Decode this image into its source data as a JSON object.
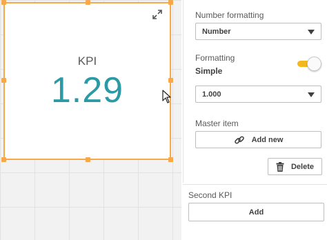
{
  "kpi": {
    "label": "KPI",
    "value": "1.29",
    "value_color": "#2b9aa5",
    "selection_color": "#f5a94a",
    "expand_icon": "expand-icon",
    "cursor_icon": "pointer-cursor-icon"
  },
  "panel": {
    "number_formatting_label": "Number formatting",
    "number_formatting_value": "Number",
    "formatting_label": "Formatting",
    "formatting_mode": "Simple",
    "formatting_toggle_on": true,
    "toggle_color": "#f3b81c",
    "format_pattern_value": "1.000",
    "master_item_label": "Master item",
    "add_new_label": "Add new",
    "add_new_icon": "link-icon",
    "delete_label": "Delete",
    "delete_icon": "trash-icon",
    "second_kpi_label": "Second KPI",
    "add_label": "Add"
  }
}
